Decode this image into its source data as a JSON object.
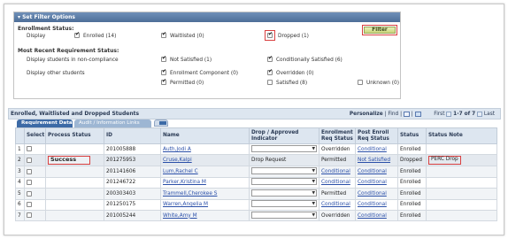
{
  "filter": {
    "header": "Set Filter Options",
    "enrollment_status_label": "Enrollment Status:",
    "display_label": "Display",
    "enrolled": "Enrolled (14)",
    "waitlisted": "Waitlisted (0)",
    "dropped": "Dropped (1)",
    "filter_button": "Filter",
    "most_recent_label": "Most Recent Requirement Status:",
    "non_compliance_label": "Display students in non-compliance",
    "not_satisfied": "Not Satisfied (1)",
    "conditionally_satisfied": "Conditionally Satisfied (6)",
    "other_students_label": "Display other students",
    "enrollment_component": "Enrollment Component (0)",
    "overridden": "Overridden (0)",
    "permitted": "Permitted (0)",
    "satisfied": "Satisfied (8)",
    "unknown": "Unknown (0)"
  },
  "grid": {
    "title": "Enrolled, Waitlisted and Dropped Students",
    "personalize": "Personalize",
    "find": "Find",
    "pager_first": "First",
    "pager_range": "1-7 of 7",
    "pager_last": "Last",
    "tabs": [
      "Requirement Data",
      "Audit / Information Links"
    ],
    "columns": [
      "",
      "Select",
      "Process Status",
      "ID",
      "Name",
      "Drop / Approved Indicator",
      "Enrollment Req Status",
      "Post Enroll Req Status",
      "Status",
      "Status Note"
    ],
    "rows": [
      {
        "num": "1",
        "process": "",
        "id": "201005888",
        "name": "Auth,Jodi A",
        "drop": "",
        "enroll_req": "Overridden",
        "post_req": "Conditional",
        "status": "Enrolled",
        "note": ""
      },
      {
        "num": "2",
        "process": "Success",
        "id": "201275953",
        "name": "Cruse,Kalpi",
        "drop": "Drop Request",
        "enroll_req": "Permitted",
        "post_req": "Not Satisfied",
        "status": "Dropped",
        "note": "PERC Drop"
      },
      {
        "num": "3",
        "process": "",
        "id": "201141606",
        "name": "Lum,Rachel C",
        "drop": "",
        "enroll_req": "Conditional",
        "post_req": "Conditional",
        "status": "Enrolled",
        "note": ""
      },
      {
        "num": "4",
        "process": "",
        "id": "201246722",
        "name": "Parker,Kristina M",
        "drop": "",
        "enroll_req": "Conditional",
        "post_req": "Conditional",
        "status": "Enrolled",
        "note": ""
      },
      {
        "num": "5",
        "process": "",
        "id": "200303403",
        "name": "Trammell,Cherokee S",
        "drop": "",
        "enroll_req": "Permitted",
        "post_req": "Conditional",
        "status": "Enrolled",
        "note": ""
      },
      {
        "num": "6",
        "process": "",
        "id": "201250175",
        "name": "Warren,Angelia M",
        "drop": "",
        "enroll_req": "Conditional",
        "post_req": "Conditional",
        "status": "Enrolled",
        "note": ""
      },
      {
        "num": "7",
        "process": "",
        "id": "201005244",
        "name": "White,Amy M",
        "drop": "",
        "enroll_req": "Overridden",
        "post_req": "Conditional",
        "status": "Enrolled",
        "note": ""
      }
    ]
  }
}
